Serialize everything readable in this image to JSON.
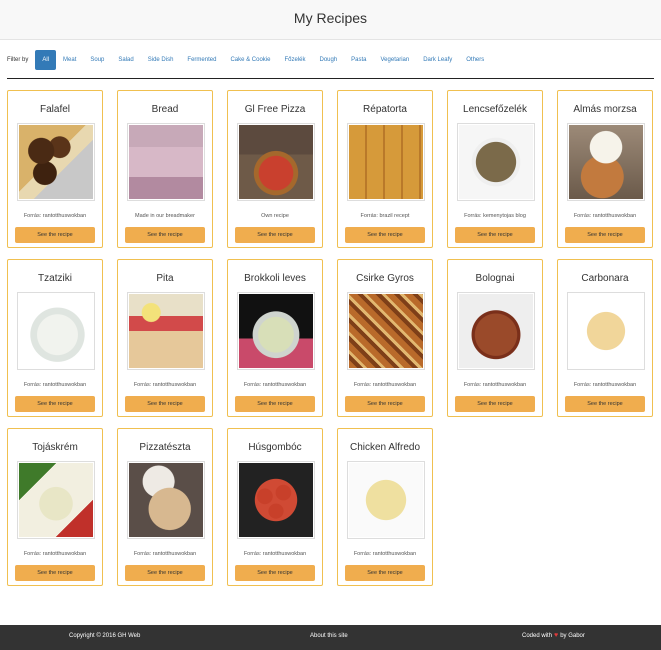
{
  "header": {
    "title": "My Recipes"
  },
  "filter": {
    "label": "Filter by",
    "items": [
      "All",
      "Meat",
      "Soup",
      "Salad",
      "Side Dish",
      "Fermented",
      "Cake & Cookie",
      "Főzelék",
      "Dough",
      "Pasta",
      "Vegetarian",
      "Dark Leafy",
      "Others"
    ],
    "active": "All"
  },
  "recipes": [
    {
      "title": "Falafel",
      "source": "Forrás: rantotthuswokban",
      "button": "See the recipe"
    },
    {
      "title": "Bread",
      "source": "Made in our breadmaker",
      "button": "See the recipe"
    },
    {
      "title": "Gl Free Pizza",
      "source": "Own recipe",
      "button": "See the recipe"
    },
    {
      "title": "Répatorta",
      "source": "Forrás: brazil recept",
      "button": "See the recipe"
    },
    {
      "title": "Lencsefőzelék",
      "source": "Forrás: kemenytojas blog",
      "button": "See the recipe"
    },
    {
      "title": "Almás morzsa",
      "source": "Forrás: rantotthuswokban",
      "button": "See the recipe"
    },
    {
      "title": "Tzatziki",
      "source": "Forrás: rantotthuswokban",
      "button": "See the recipe"
    },
    {
      "title": "Pita",
      "source": "Forrás: rantotthuswokban",
      "button": "See the recipe"
    },
    {
      "title": "Brokkoli leves",
      "source": "Forrás: rantotthuswokban",
      "button": "See the recipe"
    },
    {
      "title": "Csirke Gyros",
      "source": "Forrás: rantotthuswokban",
      "button": "See the recipe"
    },
    {
      "title": "Bolognai",
      "source": "Forrás: rantotthuswokban",
      "button": "See the recipe"
    },
    {
      "title": "Carbonara",
      "source": "Forrás: rantotthuswokban",
      "button": "See the recipe"
    },
    {
      "title": "Tojáskrém",
      "source": "Forrás: rantotthuswokban",
      "button": "See the recipe"
    },
    {
      "title": "Pizzatészta",
      "source": "Forrás: rantotthuswokban",
      "button": "See the recipe"
    },
    {
      "title": "Húsgombóc",
      "source": "Forrás: rantotthuswokban",
      "button": "See the recipe"
    },
    {
      "title": "Chicken Alfredo",
      "source": "Forrás: rantotthuswokban",
      "button": "See the recipe"
    }
  ],
  "footer": {
    "copyright": "Copyright © 2016 GH Web",
    "about": "About this site",
    "coded_prefix": "Coded with",
    "heart_icon": "heart-icon",
    "coded_suffix": "by Gabor"
  },
  "colors": {
    "accent": "#337ab7",
    "button": "#f0ad4e",
    "card_border": "#f0c050",
    "footer_bg": "#333333"
  }
}
